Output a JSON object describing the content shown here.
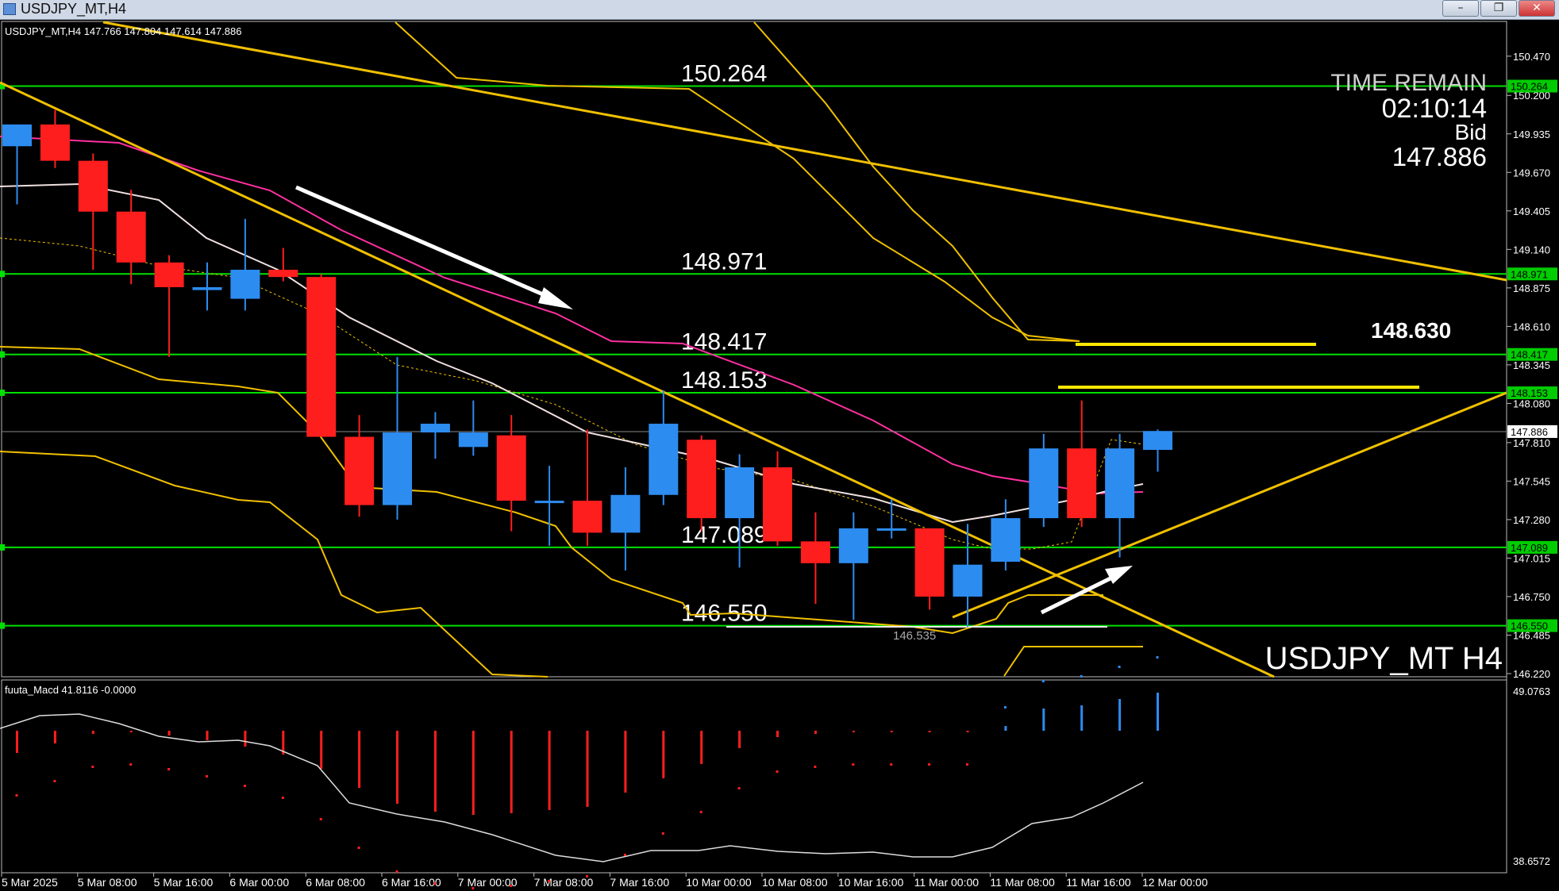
{
  "window": {
    "title": "USDJPY_MT,H4",
    "btn_min": "–",
    "btn_max": "❐",
    "btn_close": "✕"
  },
  "chart_header": "USDJPY_MT,H4  147.766 147.804 147.614 147.886",
  "watermark": "USDJPY_MT H4",
  "time_remain": {
    "label": "TIME REMAIN",
    "value": "02:10:14",
    "bid_label": "Bid",
    "bid_value": "147.886"
  },
  "highlight_level": "148.630",
  "low_marker": "146.535",
  "macd_label": "fuuta_Macd 41.8116 -0.0000",
  "colors": {
    "bull": "#2d8cf0",
    "bear": "#ff1e1e",
    "level": "#00e000",
    "trend": "#f0c000",
    "ma_pink": "#ff30a0",
    "ma_white": "#f0e0e0",
    "price_tag": "#00cc00"
  },
  "chart_data": {
    "type": "candlestick",
    "ylim": [
      146.22,
      150.6
    ],
    "y_ticks": [
      "150.470",
      "150.200",
      "149.935",
      "149.670",
      "149.405",
      "149.140",
      "148.875",
      "148.610",
      "148.345",
      "148.080",
      "147.810",
      "147.545",
      "147.280",
      "147.015",
      "146.750",
      "146.485",
      "146.220"
    ],
    "x_labels": [
      "5 Mar 2025",
      "5 Mar 08:00",
      "5 Mar 16:00",
      "6 Mar 00:00",
      "6 Mar 08:00",
      "6 Mar 16:00",
      "7 Mar 00:00",
      "7 Mar 08:00",
      "7 Mar 16:00",
      "10 Mar 00:00",
      "10 Mar 08:00",
      "10 Mar 16:00",
      "11 Mar 00:00",
      "11 Mar 08:00",
      "11 Mar 16:00",
      "12 Mar 00:00"
    ],
    "levels": [
      "150.264",
      "148.971",
      "148.417",
      "148.153",
      "147.089",
      "146.550"
    ],
    "current_price": "147.886",
    "candles": [
      {
        "o": 149.85,
        "h": 150.0,
        "l": 149.45,
        "c": 150.0
      },
      {
        "o": 150.0,
        "h": 150.1,
        "l": 149.7,
        "c": 149.75
      },
      {
        "o": 149.75,
        "h": 149.8,
        "l": 149.0,
        "c": 149.4
      },
      {
        "o": 149.4,
        "h": 149.55,
        "l": 148.9,
        "c": 149.05
      },
      {
        "o": 149.05,
        "h": 149.1,
        "l": 148.4,
        "c": 148.88
      },
      {
        "o": 148.86,
        "h": 149.05,
        "l": 148.72,
        "c": 148.88
      },
      {
        "o": 148.8,
        "h": 149.35,
        "l": 148.72,
        "c": 149.0
      },
      {
        "o": 149.0,
        "h": 149.15,
        "l": 148.92,
        "c": 148.95
      },
      {
        "o": 148.95,
        "h": 148.97,
        "l": 147.85,
        "c": 147.85
      },
      {
        "o": 147.85,
        "h": 148.0,
        "l": 147.3,
        "c": 147.38
      },
      {
        "o": 147.38,
        "h": 148.4,
        "l": 147.28,
        "c": 147.88
      },
      {
        "o": 147.88,
        "h": 148.02,
        "l": 147.7,
        "c": 147.94
      },
      {
        "o": 147.78,
        "h": 148.1,
        "l": 147.72,
        "c": 147.88
      },
      {
        "o": 147.86,
        "h": 148.0,
        "l": 147.2,
        "c": 147.41
      },
      {
        "o": 147.41,
        "h": 147.65,
        "l": 147.1,
        "c": 147.41
      },
      {
        "o": 147.41,
        "h": 147.9,
        "l": 147.1,
        "c": 147.19
      },
      {
        "o": 147.19,
        "h": 147.64,
        "l": 146.93,
        "c": 147.45
      },
      {
        "o": 147.45,
        "h": 148.17,
        "l": 147.38,
        "c": 147.94
      },
      {
        "o": 147.83,
        "h": 147.86,
        "l": 147.2,
        "c": 147.29
      },
      {
        "o": 147.29,
        "h": 147.73,
        "l": 146.95,
        "c": 147.64
      },
      {
        "o": 147.64,
        "h": 147.75,
        "l": 147.1,
        "c": 147.13
      },
      {
        "o": 147.13,
        "h": 147.33,
        "l": 146.7,
        "c": 146.98
      },
      {
        "o": 146.98,
        "h": 147.33,
        "l": 146.59,
        "c": 147.22
      },
      {
        "o": 147.22,
        "h": 147.42,
        "l": 147.15,
        "c": 147.22
      },
      {
        "o": 147.22,
        "h": 147.22,
        "l": 146.66,
        "c": 146.75
      },
      {
        "o": 146.75,
        "h": 147.25,
        "l": 146.54,
        "c": 146.97
      },
      {
        "o": 146.99,
        "h": 147.42,
        "l": 146.93,
        "c": 147.29
      },
      {
        "o": 147.29,
        "h": 147.87,
        "l": 147.23,
        "c": 147.77
      },
      {
        "o": 147.77,
        "h": 148.1,
        "l": 147.23,
        "c": 147.29
      },
      {
        "o": 147.29,
        "h": 147.87,
        "l": 147.02,
        "c": 147.77
      },
      {
        "o": 147.76,
        "h": 147.9,
        "l": 147.61,
        "c": 147.89
      }
    ],
    "macd_ylim": [
      38.6572,
      49.0763
    ],
    "macd_ticks": [
      "49.0763",
      "38.6572"
    ]
  }
}
